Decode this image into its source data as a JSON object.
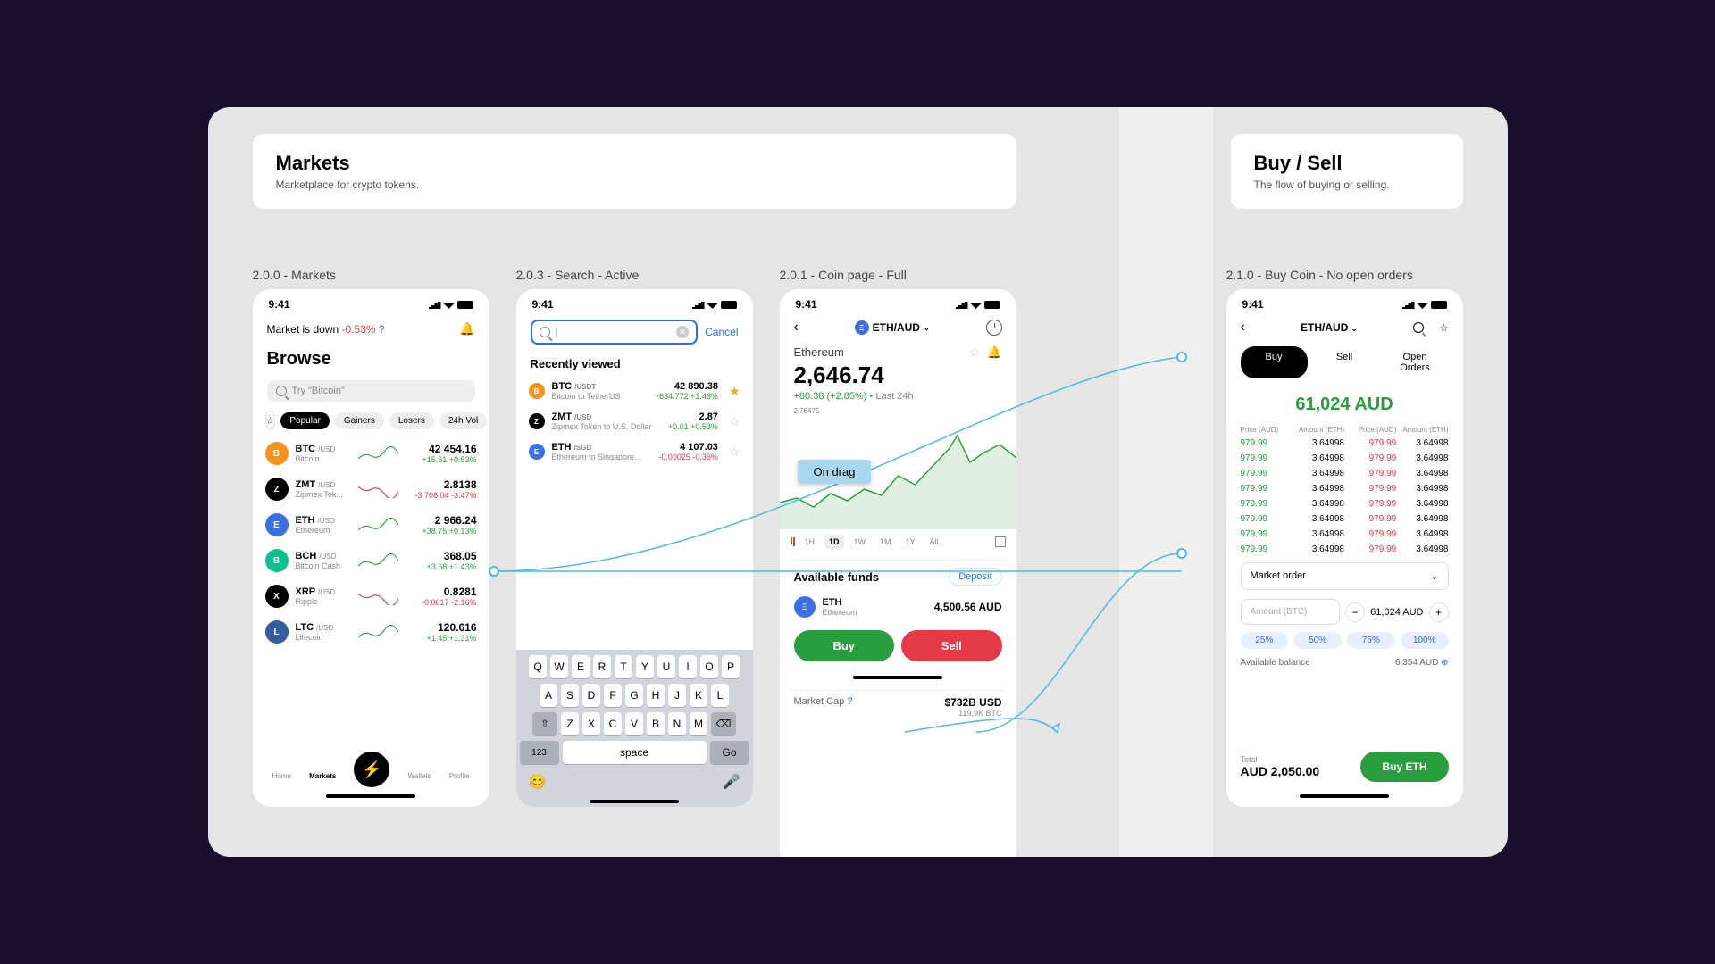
{
  "sections": {
    "markets": {
      "title": "Markets",
      "subtitle": "Marketplace for crypto tokens."
    },
    "buysell": {
      "title": "Buy / Sell",
      "subtitle": "The flow of buying or selling."
    }
  },
  "frames": {
    "markets": "2.0.0 - Markets",
    "search": "2.0.3 - Search - Active",
    "coin": "2.0.1 - Coin page - Full",
    "buy": "2.1.0 - Buy Coin - No open orders"
  },
  "status_time": "9:41",
  "markets_phone": {
    "status": {
      "text": "Market is down",
      "change": "-0.53%"
    },
    "browse": "Browse",
    "search_placeholder": "Try \"Bitcoin\"",
    "chips": [
      "Popular",
      "Gainers",
      "Losers",
      "24h Vol"
    ],
    "coins": [
      {
        "sym": "BTC",
        "pair": "/USD",
        "name": "Bitcoin",
        "price": "42 454.16",
        "change": "+15.61",
        "pct": "+0.53%",
        "up": true,
        "color": "btc"
      },
      {
        "sym": "ZMT",
        "pair": "/USD",
        "name": "Zipmex Tok...",
        "price": "2.8138",
        "change": "-3 708.04",
        "pct": "-3.47%",
        "up": false,
        "color": "zmt"
      },
      {
        "sym": "ETH",
        "pair": "/USD",
        "name": "Ethereum",
        "price": "2 966.24",
        "change": "+38.75",
        "pct": "+0.13%",
        "up": true,
        "color": "eth"
      },
      {
        "sym": "BCH",
        "pair": "/USD",
        "name": "Bitcoin Cash",
        "price": "368.05",
        "change": "+3.68",
        "pct": "+1.43%",
        "up": true,
        "color": "bch"
      },
      {
        "sym": "XRP",
        "pair": "/USD",
        "name": "Ripple",
        "price": "0.8281",
        "change": "-0.0017",
        "pct": "-2.16%",
        "up": false,
        "color": "xrp"
      },
      {
        "sym": "LTC",
        "pair": "/USD",
        "name": "Litecoin",
        "price": "120.616",
        "change": "+1.45",
        "pct": "+1.31%",
        "up": true,
        "color": "ltc"
      }
    ],
    "nav": [
      "Home",
      "Markets",
      "",
      "Wallets",
      "Profile"
    ]
  },
  "search_phone": {
    "cancel": "Cancel",
    "recent_label": "Recently viewed",
    "recent": [
      {
        "sym": "BTC",
        "pair": "/USDT",
        "name": "Bitcoin to TetherUS",
        "price": "42 890.38",
        "change": "+634.772",
        "pct": "+1.48%",
        "up": true,
        "fav": true,
        "color": "btc"
      },
      {
        "sym": "ZMT",
        "pair": "/USD",
        "name": "Zipmex Token to U.S. Dollar",
        "price": "2.87",
        "change": "+0.01",
        "pct": "+0.53%",
        "up": true,
        "fav": false,
        "color": "zmt"
      },
      {
        "sym": "ETH",
        "pair": "/SGD",
        "name": "Ethereum to Singapore...",
        "price": "4 107.03",
        "change": "-0.00025",
        "pct": "-0.36%",
        "up": false,
        "fav": false,
        "color": "eth"
      }
    ],
    "keyboard": {
      "row1": [
        "Q",
        "W",
        "E",
        "R",
        "T",
        "Y",
        "U",
        "I",
        "O",
        "P"
      ],
      "row2": [
        "A",
        "S",
        "D",
        "F",
        "G",
        "H",
        "J",
        "K",
        "L"
      ],
      "row3": [
        "Z",
        "X",
        "C",
        "V",
        "B",
        "N",
        "M"
      ],
      "num": "123",
      "space": "space",
      "go": "Go"
    }
  },
  "coin_phone": {
    "pair": "ETH/AUD",
    "name": "Ethereum",
    "price": "2,646.74",
    "change": "+80.38 (+2.85%)",
    "period": "• Last 24h",
    "stats": "2.76475",
    "drag_label": "On drag",
    "time_tabs": [
      "1H",
      "1D",
      "1W",
      "1M",
      "1Y",
      "All"
    ],
    "funds_title": "Available funds",
    "deposit": "Deposit",
    "fund": {
      "sym": "ETH",
      "name": "Ethereum",
      "amount": "4,500.56 AUD"
    },
    "buy": "Buy",
    "sell": "Sell",
    "market_cap_label": "Market Cap",
    "market_cap": "$732B USD",
    "market_cap_sub": "119.9K BTC"
  },
  "buy_phone": {
    "pair": "ETH/AUD",
    "tabs": [
      "Buy",
      "Sell",
      "Open Orders"
    ],
    "big": "61,024 AUD",
    "book_headers": [
      "Price (AUD)",
      "Amount (ETH)",
      "Price (AUD)",
      "Amount (ETH)"
    ],
    "book": [
      {
        "bp": "979.99",
        "ba": "3.64998",
        "ap": "979.99",
        "aa": "3.64998"
      },
      {
        "bp": "979.99",
        "ba": "3.64998",
        "ap": "979.99",
        "aa": "3.64998"
      },
      {
        "bp": "979.99",
        "ba": "3.64998",
        "ap": "979.99",
        "aa": "3.64998"
      },
      {
        "bp": "979.99",
        "ba": "3.64998",
        "ap": "979.99",
        "aa": "3.64998"
      },
      {
        "bp": "979.99",
        "ba": "3.64998",
        "ap": "979.99",
        "aa": "3.64998"
      },
      {
        "bp": "979.99",
        "ba": "3.64998",
        "ap": "979.99",
        "aa": "3.64998"
      },
      {
        "bp": "979.99",
        "ba": "3.64998",
        "ap": "979.99",
        "aa": "3.64998"
      },
      {
        "bp": "979.99",
        "ba": "3.64998",
        "ap": "979.99",
        "aa": "3.64998"
      }
    ],
    "order_type": "Market order",
    "amount_placeholder": "Amount (BTC)",
    "amount_display": "61,024 AUD",
    "pcts": [
      "25%",
      "50%",
      "75%",
      "100%"
    ],
    "balance_label": "Available balance",
    "balance": "6,354 AUD",
    "total_label": "Total",
    "total": "AUD 2,050.00",
    "cta": "Buy ETH"
  }
}
